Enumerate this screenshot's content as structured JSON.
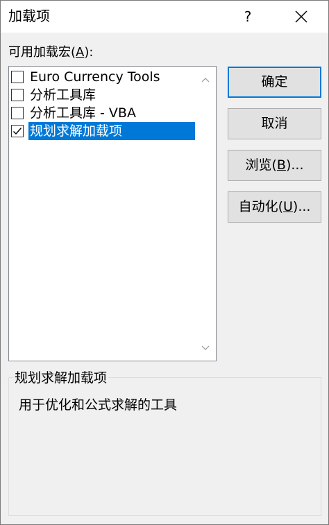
{
  "window": {
    "title": "加载项",
    "help_label": "?"
  },
  "list": {
    "label_text": "可用加载宏(",
    "label_accel": "A",
    "label_suffix": "):",
    "items": [
      {
        "label": "Euro Currency Tools",
        "checked": false,
        "selected": false
      },
      {
        "label": "分析工具库",
        "checked": false,
        "selected": false
      },
      {
        "label": "分析工具库 - VBA",
        "checked": false,
        "selected": false
      },
      {
        "label": "规划求解加载项",
        "checked": true,
        "selected": true
      }
    ]
  },
  "buttons": {
    "ok": "确定",
    "cancel": "取消",
    "browse_text": "浏览(",
    "browse_accel": "B",
    "browse_suffix": ")...",
    "automation_text": "自动化(",
    "automation_accel": "U",
    "automation_suffix": ")..."
  },
  "details": {
    "title": "规划求解加载项",
    "description": "用于优化和公式求解的工具"
  },
  "colors": {
    "selection": "#0078d7",
    "default_button_border": "#0078d7"
  }
}
